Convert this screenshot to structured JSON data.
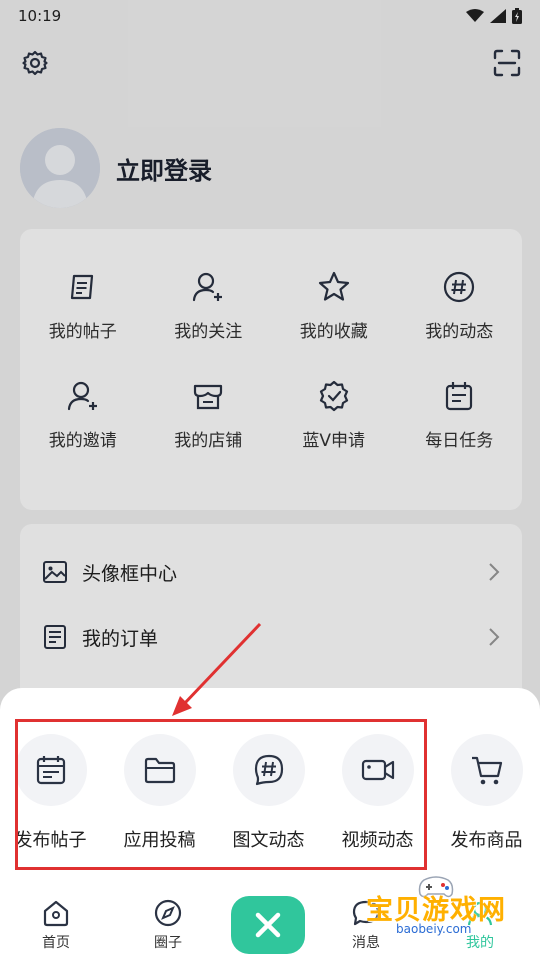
{
  "status": {
    "time": "10:19"
  },
  "profile": {
    "login_label": "立即登录"
  },
  "grid": [
    {
      "label": "我的帖子",
      "icon": "post-icon"
    },
    {
      "label": "我的关注",
      "icon": "user-follow-icon"
    },
    {
      "label": "我的收藏",
      "icon": "star-icon"
    },
    {
      "label": "我的动态",
      "icon": "hashtag-icon"
    },
    {
      "label": "我的邀请",
      "icon": "user-invite-icon"
    },
    {
      "label": "我的店铺",
      "icon": "store-icon"
    },
    {
      "label": "蓝V申请",
      "icon": "verified-badge-icon"
    },
    {
      "label": "每日任务",
      "icon": "calendar-task-icon"
    }
  ],
  "list": [
    {
      "label": "头像框中心",
      "icon": "image-frame-icon"
    },
    {
      "label": "我的订单",
      "icon": "order-list-icon"
    }
  ],
  "sheet": {
    "actions": [
      {
        "label": "发布帖子",
        "icon": "calendar-post-icon"
      },
      {
        "label": "应用投稿",
        "icon": "folder-icon"
      },
      {
        "label": "图文动态",
        "icon": "hashtag-bubble-icon"
      },
      {
        "label": "视频动态",
        "icon": "video-icon"
      },
      {
        "label": "发布商品",
        "icon": "cart-icon"
      }
    ]
  },
  "tabs": [
    {
      "label": "首页",
      "icon": "home-icon"
    },
    {
      "label": "圈子",
      "icon": "compass-icon"
    },
    {
      "label": "消息",
      "icon": "message-icon"
    },
    {
      "label": "我的",
      "icon": "profile-icon"
    }
  ],
  "watermark": {
    "title": "宝贝游戏网",
    "url": "baobeiy.com"
  },
  "colors": {
    "accent": "#30c69c",
    "highlight": "#e03131",
    "icon": "#2b3344"
  }
}
